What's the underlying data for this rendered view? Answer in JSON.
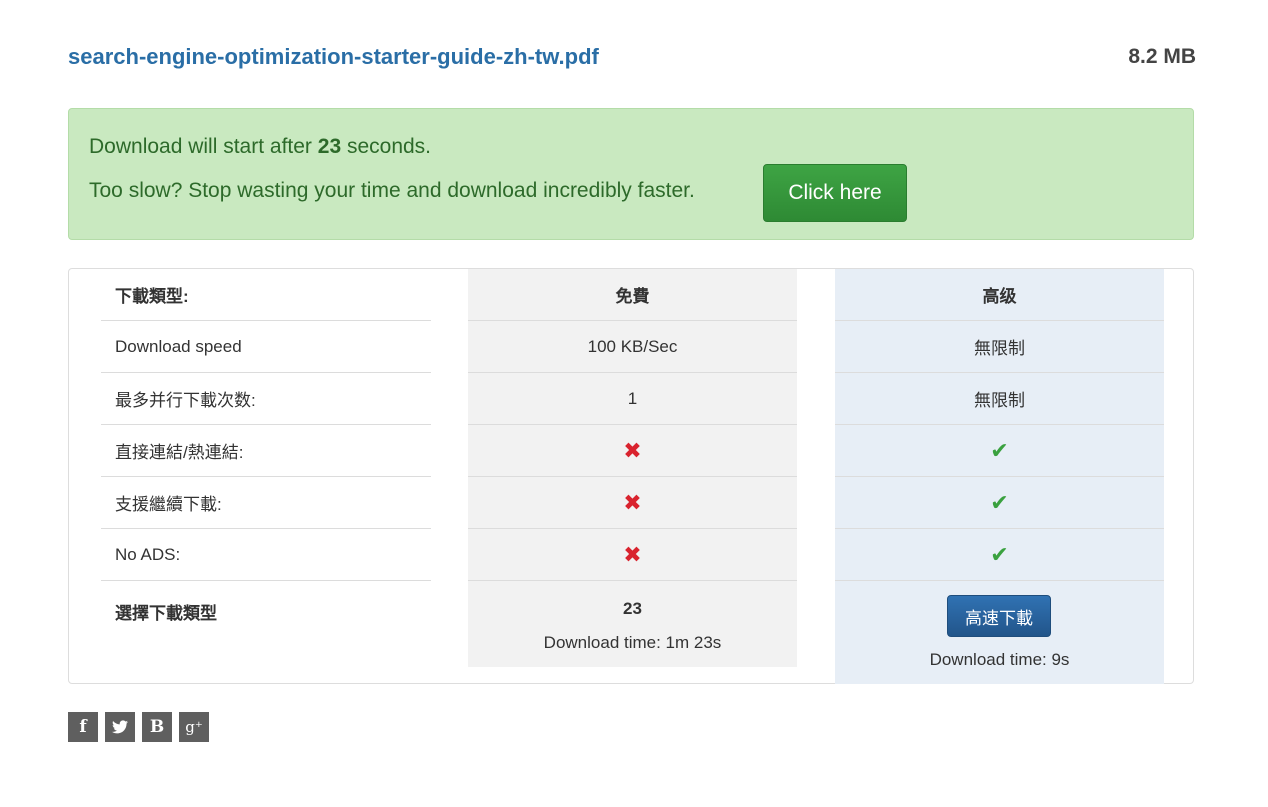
{
  "file": {
    "name": "search-engine-optimization-starter-guide-zh-tw.pdf",
    "size": "8.2 MB"
  },
  "alert": {
    "line1_prefix": "Download will start after ",
    "countdown": "23",
    "line1_suffix": " seconds.",
    "line2": "Too slow? Stop wasting your time and download incredibly faster.",
    "button": "Click here",
    "colors": {
      "background": "#c9e9c0",
      "text": "#2d6a2a",
      "button": "#3ea444"
    }
  },
  "table": {
    "header": {
      "label": "下載類型:",
      "free": "免費",
      "premium": "高级"
    },
    "rows": [
      {
        "label": "Download speed",
        "free": "100 KB/Sec",
        "premium": "無限制"
      },
      {
        "label": "最多并行下載次数:",
        "free": "1",
        "premium": "無限制"
      },
      {
        "label": "直接連結/熱連結:",
        "free_icon": "cross-icon",
        "premium_icon": "check-icon"
      },
      {
        "label": "支援繼續下載:",
        "free_icon": "cross-icon",
        "premium_icon": "check-icon"
      },
      {
        "label": "No ADS:",
        "free_icon": "cross-icon",
        "premium_icon": "check-icon"
      }
    ],
    "footer": {
      "label": "選擇下載類型",
      "free_count": "23",
      "free_time": "Download time: 1m 23s",
      "premium_button": "高速下載",
      "premium_time": "Download time: 9s"
    },
    "colors": {
      "free_column": "#f2f2f2",
      "premium_column": "#e7eef6",
      "cross": "#d9232e",
      "check": "#3aa13f"
    }
  },
  "social": [
    {
      "icon": "facebook-icon",
      "glyph": "f"
    },
    {
      "icon": "twitter-icon",
      "glyph": ""
    },
    {
      "icon": "blogger-icon",
      "glyph": "B"
    },
    {
      "icon": "google-plus-icon",
      "glyph": "g⁺"
    }
  ]
}
